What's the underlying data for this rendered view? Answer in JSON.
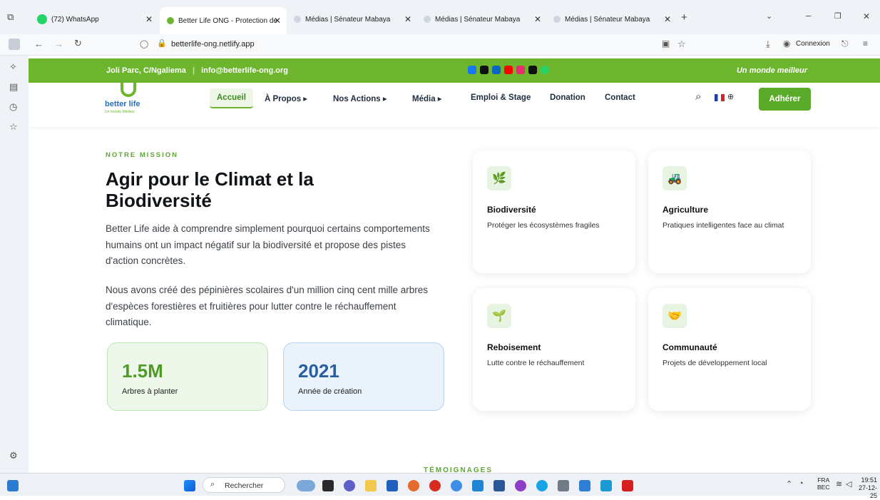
{
  "browser": {
    "tabs": [
      {
        "label": "(72) WhatsApp",
        "color": "#25d366"
      },
      {
        "label": "Better Life ONG - Protection de",
        "color": "#6cb52d"
      },
      {
        "label": "Médias | Sénateur Mabaya",
        "color": "#cfd6e0"
      },
      {
        "label": "Médias | Sénateur Mabaya",
        "color": "#cfd6e0"
      },
      {
        "label": "Médias | Sénateur Mabaya",
        "color": "#cfd6e0"
      }
    ],
    "url": "betterlife-ong.netlify.app",
    "connexion_label": "Connexion"
  },
  "topbar": {
    "address": "Joli Parc, C/Ngaliema",
    "email": "info@betterlife-ong.org",
    "slogan": "Un monde meilleur",
    "social_colors": [
      "#1877f2",
      "#111111",
      "#0a66c2",
      "#ff0000",
      "#e1306c",
      "#111111",
      "#25d366"
    ]
  },
  "logo": {
    "text": "better life",
    "tagline": "Un monde Meilleur"
  },
  "nav": {
    "items": [
      "Accueil",
      "À Propos ▸",
      "Nos Actions ▸",
      "Média ▸",
      "Emploi & Stage",
      "Donation",
      "Contact"
    ],
    "adherer_label": "Adhérer"
  },
  "hero": {
    "kicker": "NOTRE MISSION",
    "title": "Agir pour le Climat et la Biodiversité",
    "para1": "Better Life aide à comprendre simplement pourquoi certains comportements humains ont un impact négatif sur la biodiversité et propose des pistes d'action concrètes.",
    "para2": "Nous avons créé des pépinières scolaires d'un million cinq cent mille arbres d'espèces forestières et fruitières pour lutter contre le réchauffement climatique."
  },
  "stats": [
    {
      "value": "1.5M",
      "label": "Arbres à planter"
    },
    {
      "value": "2021",
      "label": "Année de création"
    }
  ],
  "cards": [
    {
      "title": "Biodiversité",
      "desc": "Protéger les écosystèmes fragiles",
      "icon": "🌿"
    },
    {
      "title": "Agriculture",
      "desc": "Pratiques intelligentes face au climat",
      "icon": "🚜"
    },
    {
      "title": "Reboisement",
      "desc": "Lutte contre le réchauffement",
      "icon": "🌱"
    },
    {
      "title": "Communauté",
      "desc": "Projets de développement local",
      "icon": "🤝"
    }
  ],
  "section_next": "TÉMOIGNAGES",
  "taskbar": {
    "search": "Rechercher",
    "lang": "FRA",
    "lang_sub": "BEC",
    "time": "19:51",
    "date": "27-12-25"
  }
}
